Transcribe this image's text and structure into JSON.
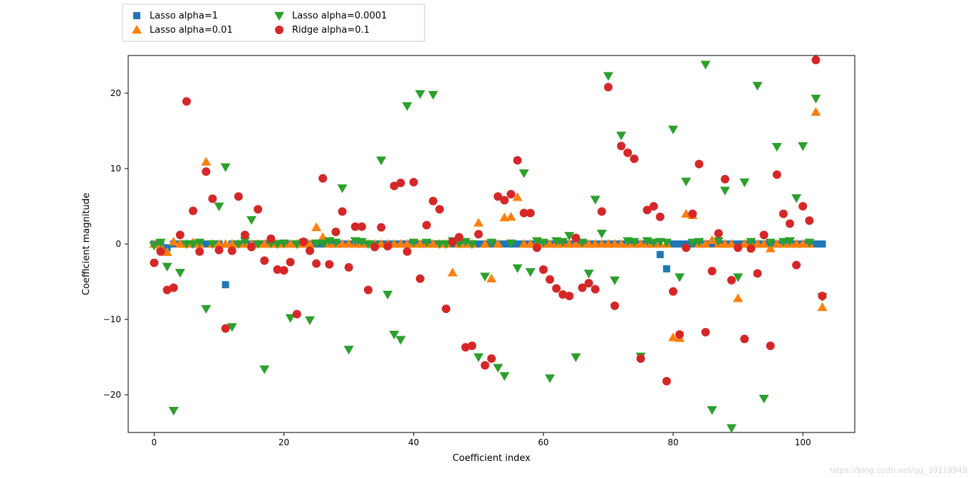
{
  "chart_data": {
    "type": "scatter",
    "title": "",
    "xlabel": "Coefficient index",
    "ylabel": "Coefficient magnitude",
    "xlim": [
      -4,
      108
    ],
    "ylim": [
      -25,
      25
    ],
    "xticks": [
      0,
      20,
      40,
      60,
      80,
      100
    ],
    "yticks": [
      -20,
      -10,
      0,
      10,
      20
    ],
    "legend": {
      "position": "top-left-outside",
      "ncol": 2,
      "entries": [
        "Lasso alpha=1",
        "Lasso alpha=0.01",
        "Lasso alpha=0.0001",
        "Ridge alpha=0.1"
      ]
    },
    "series": [
      {
        "name": "Lasso alpha=1",
        "marker": "square",
        "color": "#1f77b4",
        "note": "Most coefficients are exactly 0; a few nonzero",
        "nonzero_points": [
          {
            "x": 2,
            "y": -0.5
          },
          {
            "x": 11,
            "y": -5.4
          },
          {
            "x": 78,
            "y": -1.4
          },
          {
            "x": 79,
            "y": -3.3
          }
        ],
        "zero_indices_range": [
          0,
          103
        ]
      },
      {
        "name": "Lasso alpha=0.01",
        "marker": "triangle-up",
        "color": "#ff7f0e",
        "note": "Many coefficients near 0, some moderate",
        "values": [
          0,
          -0.3,
          -1.1,
          0.3,
          0,
          0,
          0.2,
          0,
          10.9,
          0,
          0,
          0,
          0,
          0,
          0,
          0,
          0,
          0,
          0,
          0,
          0,
          0,
          0,
          0,
          0,
          2.2,
          0.9,
          0,
          0,
          0,
          0,
          0,
          0,
          0,
          0,
          0,
          0,
          0,
          0,
          0,
          0,
          0,
          0,
          0,
          0,
          0,
          -3.8,
          0,
          0,
          0,
          2.8,
          0,
          -4.6,
          0,
          3.5,
          3.6,
          6.2,
          0,
          0,
          0,
          0,
          0,
          0,
          0,
          0,
          0,
          0,
          0,
          0,
          0,
          0,
          0,
          0,
          0,
          0,
          0,
          0,
          0,
          0,
          0,
          -12.4,
          -12.5,
          4.0,
          3.8,
          0,
          0,
          0.5,
          0,
          0,
          0,
          -7.2,
          0,
          0,
          0,
          0,
          -0.6,
          0,
          0,
          0,
          0,
          0,
          0,
          17.5,
          -8.4
        ]
      },
      {
        "name": "Lasso alpha=0.0001",
        "marker": "triangle-down",
        "color": "#2ca02c",
        "note": "Wide spread, many large magnitude",
        "values": [
          -0.2,
          0.2,
          -3.0,
          -22.1,
          -3.8,
          0,
          0,
          0.2,
          -8.6,
          0,
          5.0,
          10.2,
          -11.0,
          0,
          0.4,
          3.2,
          0,
          -16.6,
          0.1,
          0,
          0.1,
          -9.8,
          0,
          0.2,
          -10.1,
          0.1,
          0.1,
          0.4,
          0.2,
          7.4,
          -14.0,
          0.4,
          0.3,
          0,
          -0.2,
          11.1,
          -6.7,
          -12.0,
          -12.7,
          18.3,
          0.2,
          19.9,
          0.2,
          19.8,
          0,
          0,
          0.4,
          0.1,
          0.3,
          0,
          -15.0,
          -4.3,
          0.2,
          -16.4,
          -17.5,
          0.1,
          -3.2,
          9.4,
          -3.7,
          0.4,
          0.2,
          -17.8,
          0.4,
          0.3,
          1.1,
          -15.0,
          0.2,
          -3.9,
          5.9,
          1.4,
          22.3,
          -4.8,
          14.4,
          0.4,
          0.3,
          -14.9,
          0.4,
          0.2,
          0.3,
          0.2,
          15.2,
          -4.4,
          8.3,
          0.2,
          0.3,
          23.8,
          -22.0,
          0.4,
          7.1,
          -24.4,
          -4.4,
          8.2,
          0.3,
          21.0,
          -20.5,
          0.2,
          12.9,
          0.3,
          0.4,
          6.1,
          13.0,
          0.2,
          19.3,
          -7.0
        ]
      },
      {
        "name": "Ridge alpha=0.1",
        "marker": "circle",
        "color": "#d62728",
        "note": "All nonzero, moderate spread",
        "values": [
          -2.5,
          -1.0,
          -6.1,
          -5.8,
          1.2,
          18.9,
          4.4,
          -1.0,
          9.6,
          6.0,
          -0.8,
          -11.2,
          -0.9,
          6.3,
          1.2,
          -0.4,
          4.6,
          -2.2,
          0.7,
          -3.4,
          -3.5,
          -2.4,
          -9.3,
          0.3,
          -0.9,
          -2.6,
          8.7,
          -2.7,
          1.6,
          4.3,
          -3.1,
          2.3,
          2.3,
          -6.1,
          -0.4,
          2.2,
          -0.3,
          7.7,
          8.1,
          -1.0,
          8.2,
          -4.6,
          2.5,
          5.7,
          4.6,
          -8.6,
          0.3,
          0.9,
          -13.7,
          -13.5,
          1.3,
          -16.1,
          -15.2,
          6.3,
          5.8,
          6.6,
          11.1,
          4.1,
          4.1,
          -0.5,
          -3.4,
          -4.7,
          -5.9,
          -6.7,
          -6.9,
          0.8,
          -5.8,
          -5.2,
          -6.0,
          4.3,
          20.8,
          -8.2,
          13.0,
          12.1,
          11.3,
          -15.2,
          4.5,
          5.0,
          3.6,
          -18.2,
          -6.3,
          -12.0,
          -0.5,
          4.0,
          10.6,
          -11.7,
          -3.6,
          1.4,
          8.6,
          -4.8,
          -0.5,
          -12.6,
          -0.6,
          -3.9,
          1.2,
          -13.5,
          9.2,
          4.0,
          2.7,
          -2.8,
          5.0,
          3.1,
          24.4,
          -6.9
        ]
      }
    ]
  },
  "watermark": "https://blog.csdn.net/qq_39119949"
}
